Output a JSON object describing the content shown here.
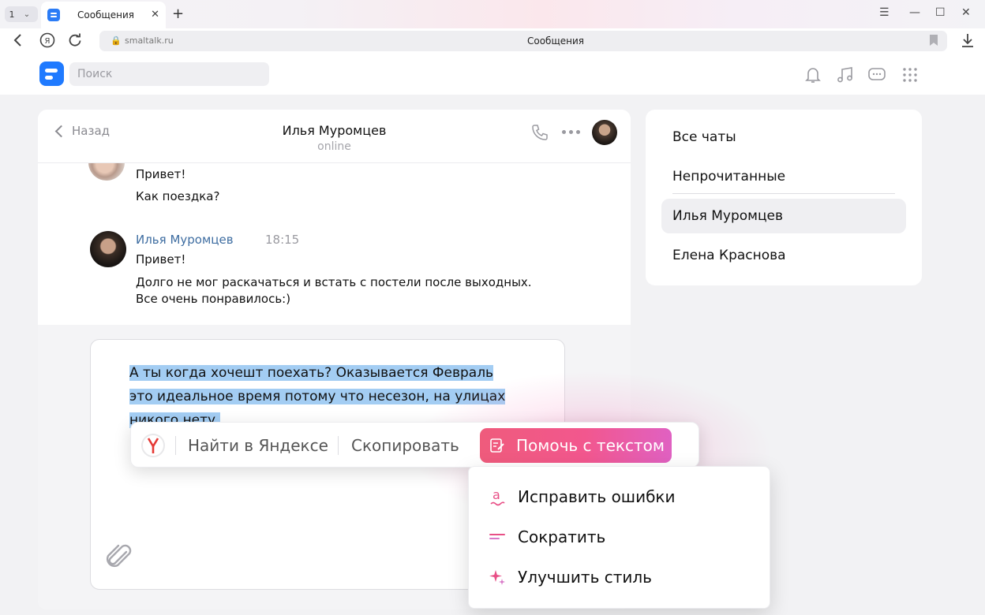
{
  "browser": {
    "tab_count": "1",
    "tab_title": "Сообщения",
    "url_host": "smaltalk.ru",
    "page_title": "Сообщения"
  },
  "app": {
    "search_placeholder": "Поиск"
  },
  "chat": {
    "back_label": "Назад",
    "peer_name": "Илья Муромцев",
    "peer_status": "online",
    "messages": [
      {
        "lines": [
          "Привет!",
          "Как поездка?"
        ]
      },
      {
        "sender": "Илья Муромцев",
        "time": "18:15",
        "lines": [
          "Привет!",
          "Долго не мог раскачаться и встать с постели после выходных.",
          "Все очень понравилось:)"
        ]
      }
    ],
    "draft_lines": [
      "А ты когда хочешт поехать? Оказывается Февраль",
      "это идеальное время потому что несезон, на улицах",
      "никого нету."
    ]
  },
  "selection_toolbar": {
    "search_label": "Найти в Яндексе",
    "copy_label": "Скопировать",
    "ai_label": "Помочь с текстом"
  },
  "ai_menu": {
    "items": [
      {
        "label": "Исправить ошибки",
        "icon": "letter-a-icon"
      },
      {
        "label": "Сократить",
        "icon": "shorten-lines-icon"
      },
      {
        "label": "Улучшить стиль",
        "icon": "sparkles-icon"
      }
    ]
  },
  "sidebar": {
    "items": [
      {
        "label": "Все чаты"
      },
      {
        "label": "Непрочитанные"
      },
      {
        "label": "Илья Муромцев",
        "active": true
      },
      {
        "label": "Елена Краснова"
      }
    ]
  },
  "colors": {
    "accent_blue": "#1f7aff",
    "ai_gradient_start": "#ef5b7c",
    "ai_gradient_end": "#e061c2",
    "selection": "#a3cdf3",
    "sender_name": "#3e6da1"
  }
}
